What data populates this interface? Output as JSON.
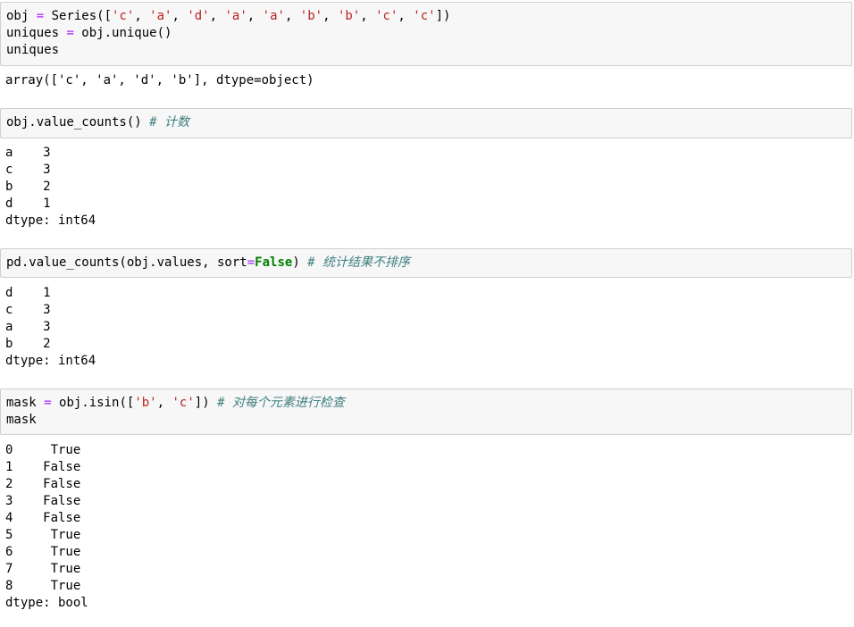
{
  "cells": [
    {
      "input": [
        [
          {
            "t": "obj ",
            "c": "plain"
          },
          {
            "t": "=",
            "c": "op"
          },
          {
            "t": " Series([",
            "c": "plain"
          },
          {
            "t": "'c'",
            "c": "str"
          },
          {
            "t": ", ",
            "c": "plain"
          },
          {
            "t": "'a'",
            "c": "str"
          },
          {
            "t": ", ",
            "c": "plain"
          },
          {
            "t": "'d'",
            "c": "str"
          },
          {
            "t": ", ",
            "c": "plain"
          },
          {
            "t": "'a'",
            "c": "str"
          },
          {
            "t": ", ",
            "c": "plain"
          },
          {
            "t": "'a'",
            "c": "str"
          },
          {
            "t": ", ",
            "c": "plain"
          },
          {
            "t": "'b'",
            "c": "str"
          },
          {
            "t": ", ",
            "c": "plain"
          },
          {
            "t": "'b'",
            "c": "str"
          },
          {
            "t": ", ",
            "c": "plain"
          },
          {
            "t": "'c'",
            "c": "str"
          },
          {
            "t": ", ",
            "c": "plain"
          },
          {
            "t": "'c'",
            "c": "str"
          },
          {
            "t": "])",
            "c": "plain"
          }
        ],
        [
          {
            "t": "uniques ",
            "c": "plain"
          },
          {
            "t": "=",
            "c": "op"
          },
          {
            "t": " obj.unique()",
            "c": "plain"
          }
        ],
        [
          {
            "t": "uniques",
            "c": "plain"
          }
        ]
      ],
      "output": [
        "array(['c', 'a', 'd', 'b'], dtype=object)"
      ]
    },
    {
      "input": [
        [
          {
            "t": "obj.value_counts() ",
            "c": "plain"
          },
          {
            "t": "# 计数",
            "c": "cm"
          }
        ]
      ],
      "output": [
        "a    3",
        "c    3",
        "b    2",
        "d    1",
        "dtype: int64"
      ]
    },
    {
      "input": [
        [
          {
            "t": "pd.value_counts(obj.values, sort",
            "c": "plain"
          },
          {
            "t": "=",
            "c": "op"
          },
          {
            "t": "False",
            "c": "kw"
          },
          {
            "t": ") ",
            "c": "plain"
          },
          {
            "t": "# 统计结果不排序",
            "c": "cm"
          }
        ]
      ],
      "output": [
        "d    1",
        "c    3",
        "a    3",
        "b    2",
        "dtype: int64"
      ]
    },
    {
      "input": [
        [
          {
            "t": "mask ",
            "c": "plain"
          },
          {
            "t": "=",
            "c": "op"
          },
          {
            "t": " obj.isin([",
            "c": "plain"
          },
          {
            "t": "'b'",
            "c": "str"
          },
          {
            "t": ", ",
            "c": "plain"
          },
          {
            "t": "'c'",
            "c": "str"
          },
          {
            "t": "]) ",
            "c": "plain"
          },
          {
            "t": "# 对每个元素进行检查",
            "c": "cm"
          }
        ],
        [
          {
            "t": "mask",
            "c": "plain"
          }
        ]
      ],
      "output": [
        "0     True",
        "1    False",
        "2    False",
        "3    False",
        "4    False",
        "5     True",
        "6     True",
        "7     True",
        "8     True",
        "dtype: bool"
      ]
    }
  ]
}
